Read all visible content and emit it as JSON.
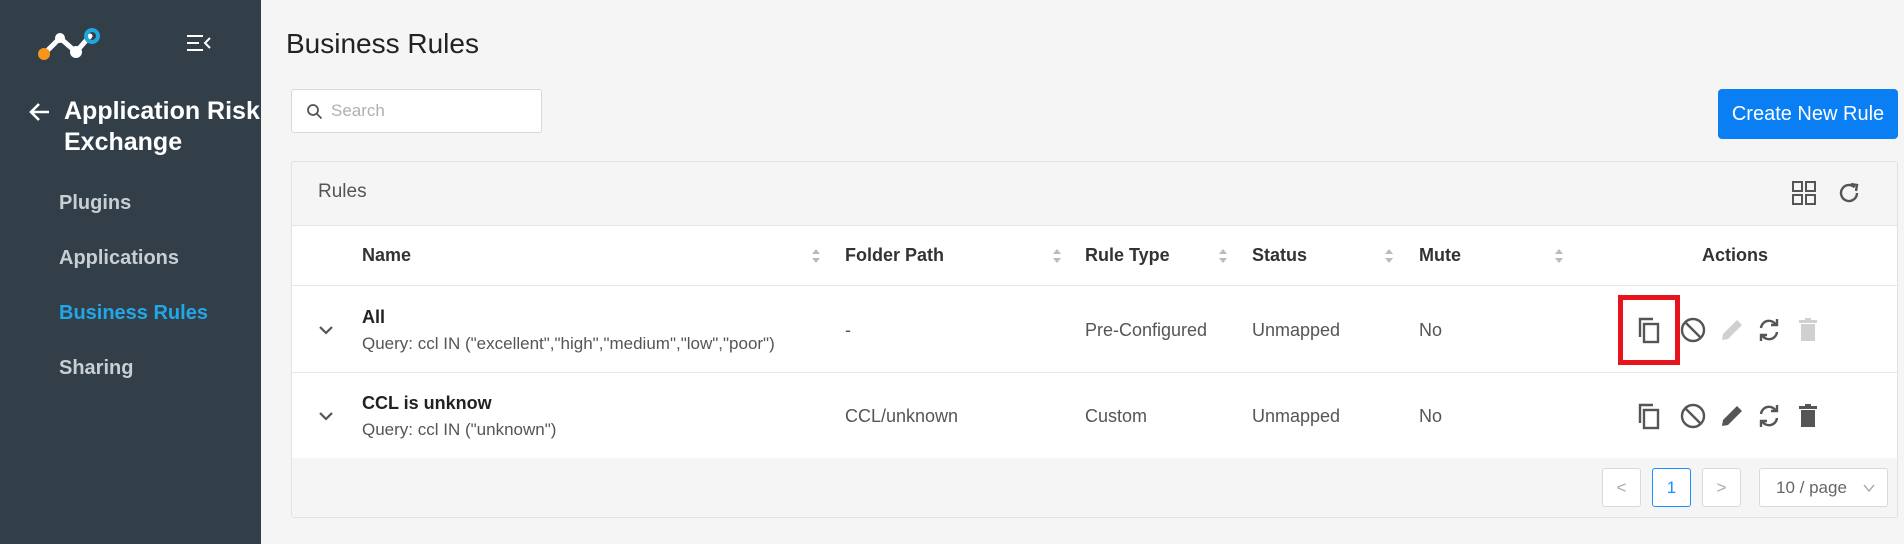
{
  "sidebar": {
    "app_title": "Application Risk Exchange",
    "items": [
      {
        "label": "Plugins",
        "active": false
      },
      {
        "label": "Applications",
        "active": false
      },
      {
        "label": "Business Rules",
        "active": true
      },
      {
        "label": "Sharing",
        "active": false
      }
    ]
  },
  "header": {
    "page_title": "Business Rules",
    "search_placeholder": "Search",
    "create_label": "Create New Rule"
  },
  "card": {
    "title": "Rules",
    "columns": [
      "Name",
      "Folder Path",
      "Rule Type",
      "Status",
      "Mute",
      "Actions"
    ],
    "rows": [
      {
        "name": "All",
        "query": "Query: ccl IN (\"excellent\",\"high\",\"medium\",\"low\",\"poor\")",
        "folder": "-",
        "type": "Pre-Configured",
        "status": "Unmapped",
        "mute": "No",
        "edit_enabled": false,
        "delete_enabled": false,
        "copy_highlighted": true
      },
      {
        "name": "CCL is unknow",
        "query": "Query: ccl IN (\"unknown\")",
        "folder": "CCL/unknown",
        "type": "Custom",
        "status": "Unmapped",
        "mute": "No",
        "edit_enabled": true,
        "delete_enabled": true,
        "copy_highlighted": false
      }
    ]
  },
  "pagination": {
    "prev": "<",
    "current_page": "1",
    "next": ">",
    "page_size": "10 / page"
  },
  "colors": {
    "sidebar_bg": "#323f48",
    "accent": "#23a6e8",
    "primary_button": "#0a7ef3",
    "highlight": "#e8141d"
  }
}
